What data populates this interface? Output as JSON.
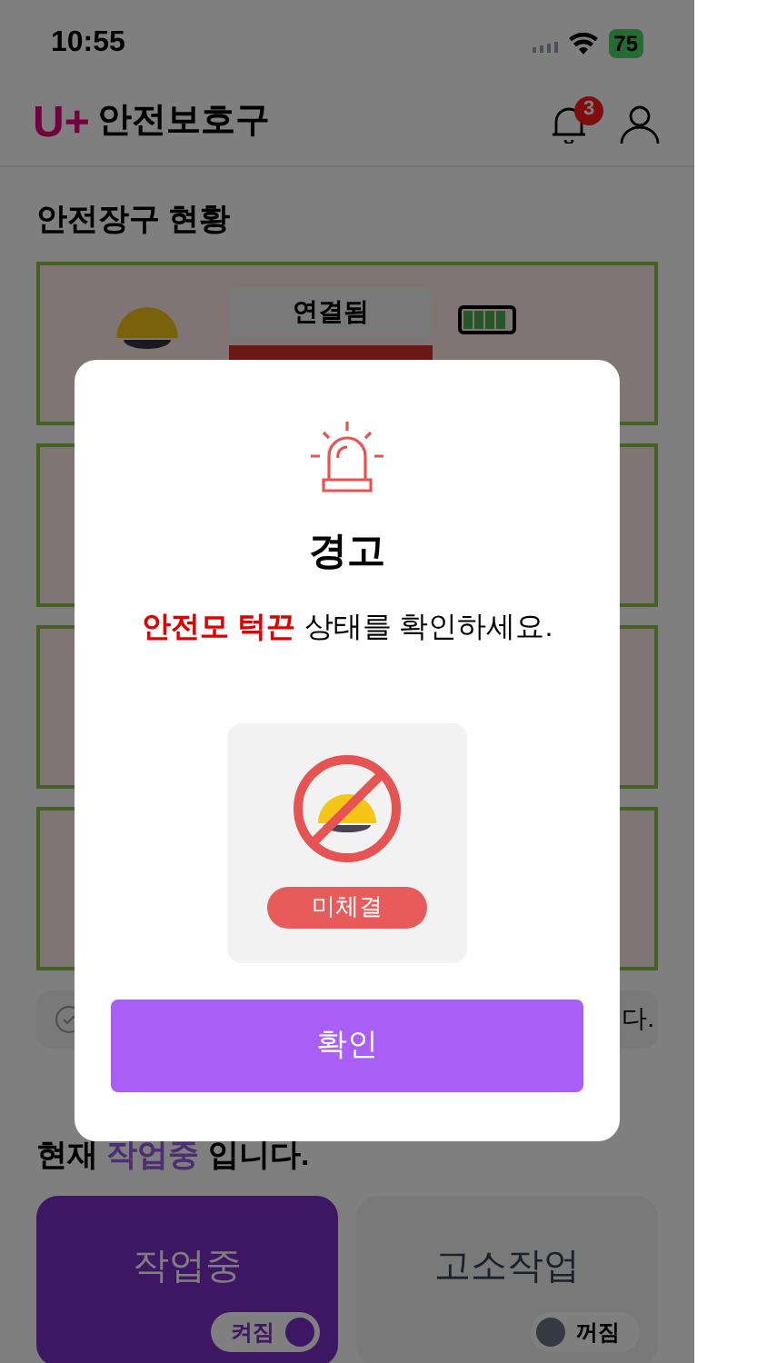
{
  "status_bar": {
    "time": "10:55",
    "battery": "75"
  },
  "header": {
    "logo": "U+",
    "title": "안전보호구",
    "notification_count": "3"
  },
  "section_title": "안전장구 현황",
  "devices": [
    {
      "kind": "helmet",
      "status": "연결됨",
      "battery": {
        "level": 1
      }
    },
    {
      "kind": "covered"
    },
    {
      "kind": "covered"
    },
    {
      "kind": "covered"
    }
  ],
  "notice": {
    "text": "다."
  },
  "work_heading": "현재 **작업중** 입니다.",
  "work_modes": [
    {
      "label": "작업중",
      "selected": true,
      "toggle": {
        "label": "켜짐",
        "on": true
      }
    },
    {
      "label": "고소작업",
      "selected": false,
      "toggle": {
        "label": "꺼짐",
        "on": false
      }
    }
  ],
  "dialog": {
    "title": "경고",
    "message": "안전모 턱끈",
    "message_rest": "상태를 확인하세요.",
    "badge": "미체결",
    "button": "확인"
  }
}
